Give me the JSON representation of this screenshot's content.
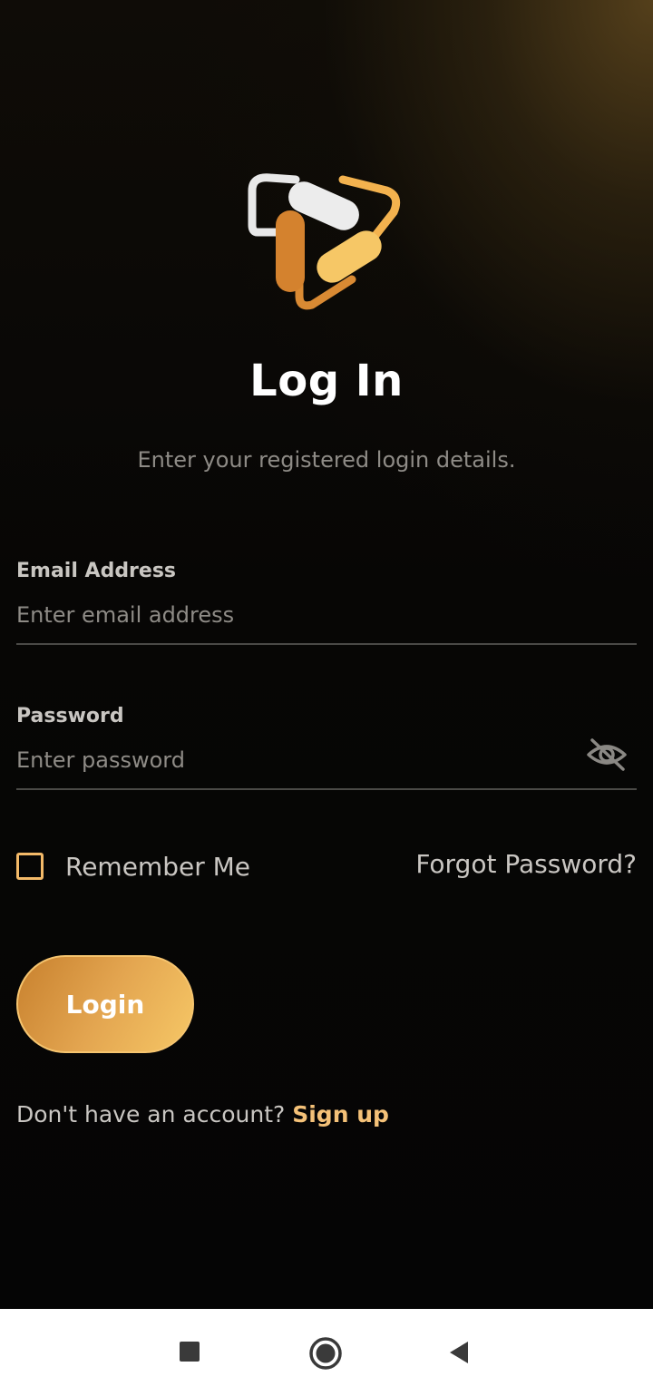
{
  "app": {
    "title": "Log In",
    "subtitle": "Enter your registered login details.",
    "logo_icon": "app-logo-triangle-icon",
    "brand_colors": {
      "gold": "#F6C766",
      "orange": "#D4822E",
      "white": "#EDEDED"
    }
  },
  "form": {
    "email": {
      "label": "Email Address",
      "placeholder": "Enter email address",
      "value": ""
    },
    "password": {
      "label": "Password",
      "placeholder": "Enter password",
      "value": "",
      "visibility_icon": "eye-off-icon"
    },
    "remember": {
      "label": "Remember Me",
      "checked": false
    },
    "forgot_label": "Forgot Password?",
    "login_label": "Login",
    "signup_prompt": "Don't have an account?",
    "signup_label": "Sign up"
  },
  "navbar": {
    "buttons": [
      {
        "name": "recents-button",
        "icon": "square-icon"
      },
      {
        "name": "home-button",
        "icon": "circle-icon"
      },
      {
        "name": "back-button",
        "icon": "triangle-back-icon"
      }
    ]
  }
}
